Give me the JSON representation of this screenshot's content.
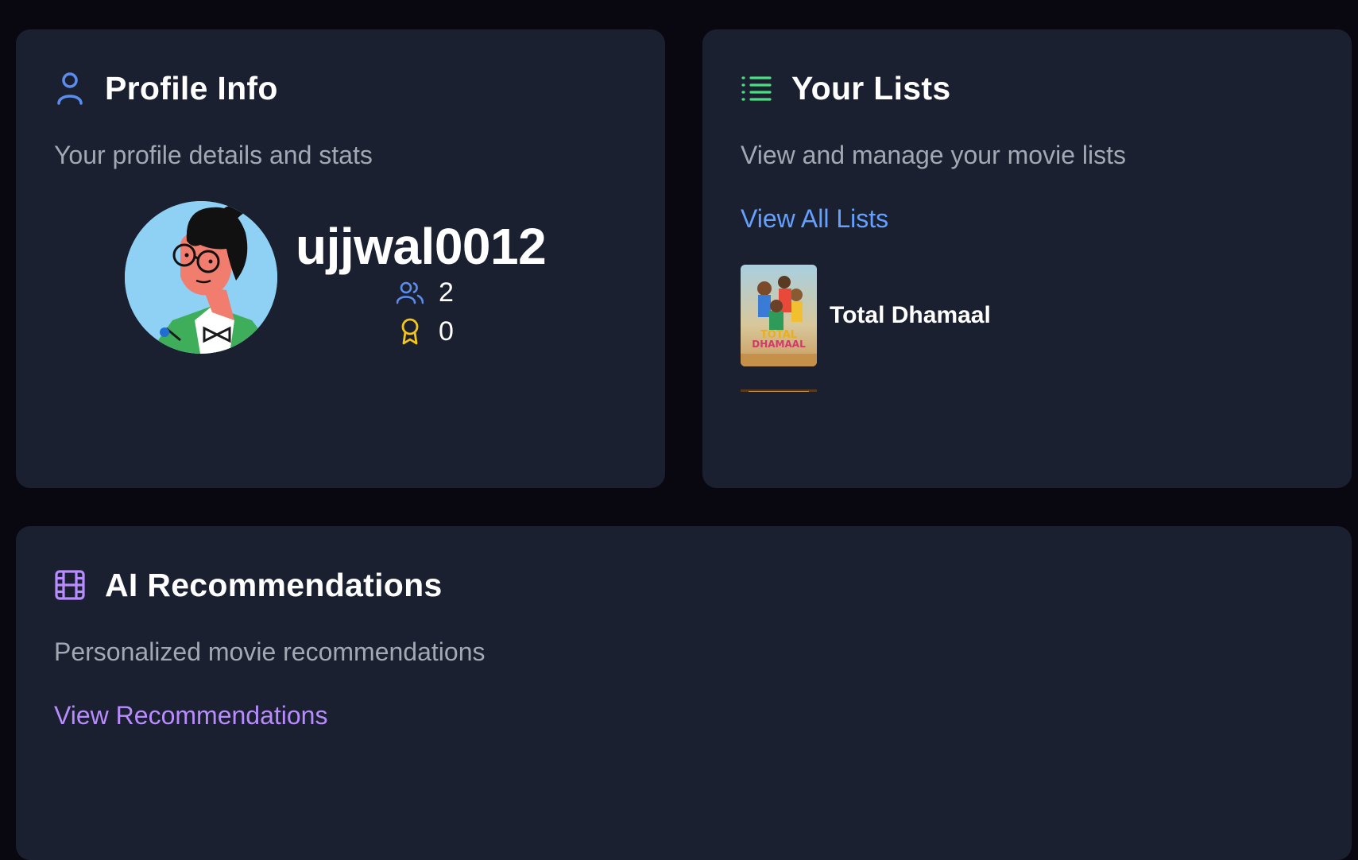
{
  "profile": {
    "title": "Profile Info",
    "subtitle": "Your profile details and stats",
    "username": "ujjwal0012",
    "friends_count": "2",
    "awards_count": "0",
    "icon": "user-icon",
    "accent_color": "#5b8def"
  },
  "lists": {
    "title": "Your Lists",
    "subtitle": "View and manage your movie lists",
    "view_all_label": "View All Lists",
    "icon": "list-icon",
    "accent_color": "#4ade80",
    "items": [
      {
        "title": "Total Dhamaal"
      }
    ]
  },
  "recommendations": {
    "title": "AI Recommendations",
    "subtitle": "Personalized movie recommendations",
    "view_label": "View Recommendations",
    "icon": "film-icon",
    "accent_color": "#b88cff"
  }
}
